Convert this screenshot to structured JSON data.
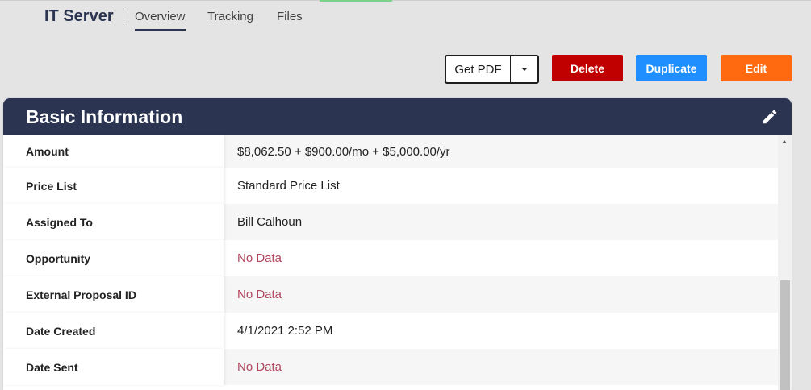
{
  "header": {
    "title": "IT Server",
    "tabs": [
      {
        "label": "Overview",
        "active": true
      },
      {
        "label": "Tracking",
        "active": false
      },
      {
        "label": "Files",
        "active": false
      }
    ]
  },
  "actions": {
    "get_pdf": "Get PDF",
    "delete": "Delete",
    "duplicate": "Duplicate",
    "edit": "Edit"
  },
  "colors": {
    "header_navy": "#2b3451",
    "delete": "#c00000",
    "duplicate": "#1f8fff",
    "edit": "#ff6a10",
    "no_data": "#b0475e"
  },
  "card": {
    "title": "Basic Information",
    "edit_icon": "pencil-icon",
    "rows": [
      {
        "label": "Amount",
        "value": "$8,062.50 + $900.00/mo + $5,000.00/yr",
        "no_data": false
      },
      {
        "label": "Price List",
        "value": "Standard Price List",
        "no_data": false
      },
      {
        "label": "Assigned To",
        "value": "Bill Calhoun",
        "no_data": false
      },
      {
        "label": "Opportunity",
        "value": "No Data",
        "no_data": true
      },
      {
        "label": "External Proposal ID",
        "value": "No Data",
        "no_data": true
      },
      {
        "label": "Date Created",
        "value": "4/1/2021 2:52 PM",
        "no_data": false
      },
      {
        "label": "Date Sent",
        "value": "No Data",
        "no_data": true
      }
    ]
  }
}
